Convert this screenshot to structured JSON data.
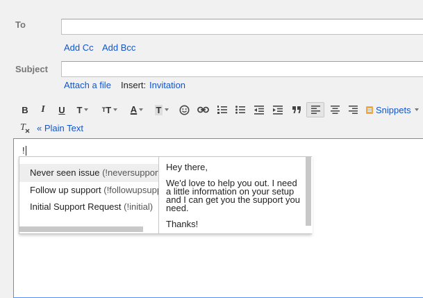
{
  "compose": {
    "to_label": "To",
    "to_value": "",
    "add_cc": "Add Cc",
    "add_bcc": "Add Bcc",
    "subject_label": "Subject",
    "subject_value": "",
    "attach_file": "Attach a file",
    "insert_label": "Insert:",
    "invitation": "Invitation"
  },
  "toolbar": {
    "bold": "B",
    "italic": "I",
    "underline": "U",
    "font": "T",
    "size": "T",
    "text_color": "A",
    "highlight": "T",
    "snippets": "Snippets",
    "plain_text": "« Plain Text"
  },
  "editor": {
    "typed_text": "!"
  },
  "snippets_popup": {
    "items": [
      {
        "name": "Never seen issue ",
        "key": "(!neversupport)"
      },
      {
        "name": "Follow up support ",
        "key": "(!followupsupport)"
      },
      {
        "name": "Initial Support Request ",
        "key": "(!initial)"
      }
    ],
    "preview": {
      "greeting": "Hey there,",
      "body": "We'd love to help you out. I need a little information on your setup and I can get you the support you need.",
      "closing": "Thanks!"
    }
  },
  "colors": {
    "link": "#1155cc",
    "focus_border": "#4d90fe",
    "snippets_icon": "#f4a83a"
  }
}
